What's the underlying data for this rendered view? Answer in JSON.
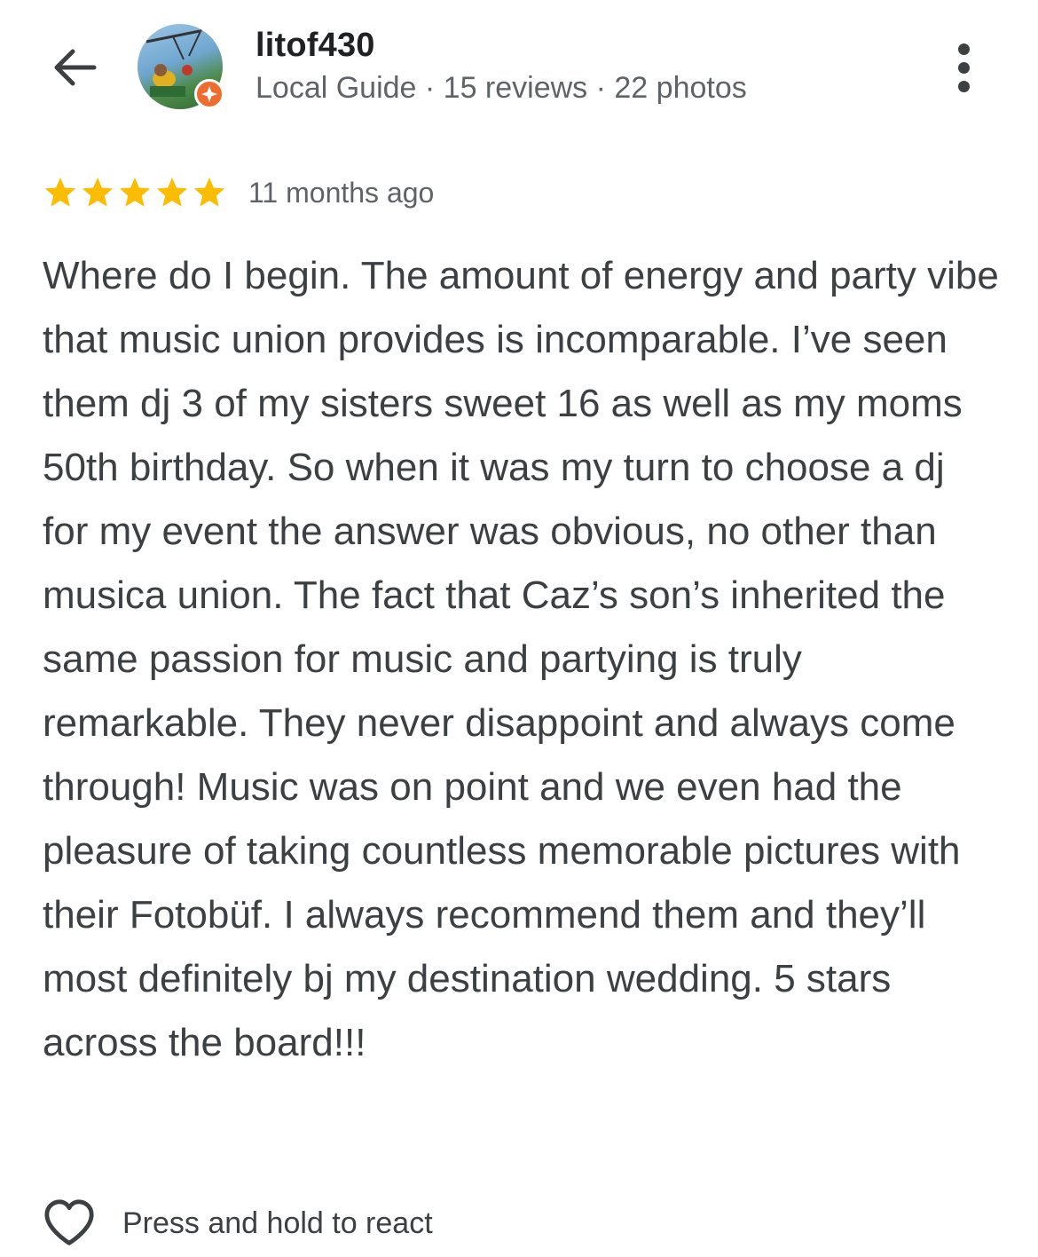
{
  "header": {
    "back_icon": "arrow-back-icon",
    "user_name": "litof430",
    "user_meta": "Local Guide · 15 reviews · 22 photos",
    "badge_icon": "local-guide-badge-icon",
    "more_icon": "more-vertical-icon"
  },
  "review": {
    "rating": 5,
    "max_rating": 5,
    "star_color": "#fbbc04",
    "time_ago": "11 months ago",
    "text": "Where do I begin. The amount of energy and party vibe that music union provides is incomparable. I’ve seen them dj 3 of my sisters sweet 16 as well as my moms 50th birthday. So when it was my turn to choose a dj for my event the answer was obvious, no other than musica union. The fact that Caz’s son’s inherited the same passion for music and partying is truly remarkable. They never disappoint and always come through! Music was on point and we even had the pleasure of taking countless memorable pictures with their Fotobüf. I always recommend them and they’ll most definitely bj my destination wedding. 5 stars across the board!!!"
  },
  "react": {
    "icon": "heart-outline-icon",
    "label": "Press and hold to react"
  },
  "colors": {
    "text_primary": "#202124",
    "text_body": "#3c4043",
    "text_secondary": "#5f6368",
    "badge": "#ef6c2f"
  }
}
